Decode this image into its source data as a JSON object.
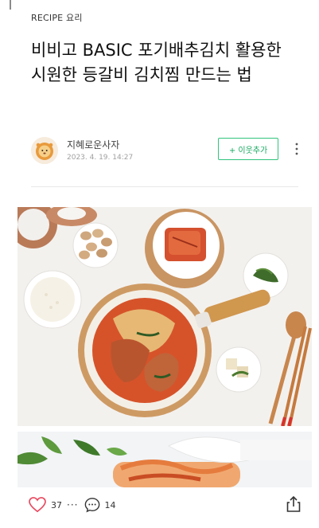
{
  "post": {
    "category": "RECIPE 요리",
    "title": "비비고 BASIC 포기배추김치 활용한 시원한 등갈비 김치찜 만드는 법"
  },
  "author": {
    "name": "지혜로운사자",
    "date": "2023. 4. 19. 14:27",
    "follow_label": "+ 이웃추가",
    "avatar_icon": "lion-avatar-icon"
  },
  "photos": [
    {
      "name": "kimchi-jjim-hero-photo",
      "subject": "kimchi-jjim-pot-with-side-dishes"
    },
    {
      "name": "kimchi-handling-photo",
      "subject": "gloved-hand-holding-kimchi"
    }
  ],
  "actions": {
    "like_count": "37",
    "separator": "···",
    "comment_count": "14",
    "icons": [
      "heart-icon",
      "comment-icon",
      "share-icon",
      "more-icon"
    ]
  },
  "colors": {
    "like": "#e8475d",
    "follow": "#16a85f",
    "follow_border": "#30c47c"
  }
}
